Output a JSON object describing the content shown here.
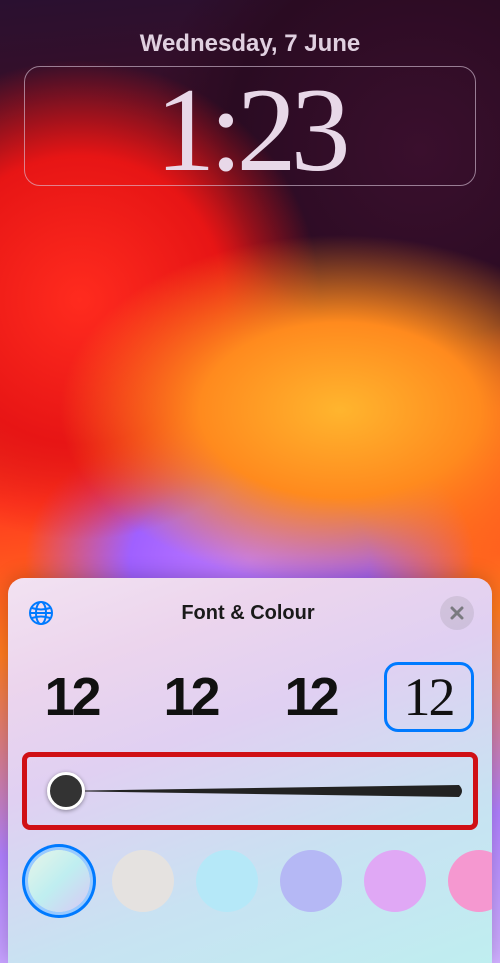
{
  "lockscreen": {
    "date": "Wednesday, 7 June",
    "time": "1:23"
  },
  "sheet": {
    "title": "Font & Colour",
    "globe_icon": "globe-icon",
    "close_icon": "close-icon",
    "fonts": [
      {
        "sample": "12",
        "selected": false
      },
      {
        "sample": "12",
        "selected": false
      },
      {
        "sample": "12",
        "selected": false
      },
      {
        "sample": "12",
        "selected": true
      }
    ],
    "slider": {
      "value": 0,
      "min": 0,
      "max": 100,
      "highlighted": true,
      "highlight_color": "#d01015"
    },
    "colors": [
      {
        "css": "linear-gradient(135deg,#e8f5e8 0%,#bfeef0 50%,#d8c8f5 100%)",
        "selected": true
      },
      {
        "css": "#e5e2e0",
        "selected": false
      },
      {
        "css": "#b5e8f8",
        "selected": false
      },
      {
        "css": "#b5b8f5",
        "selected": false
      },
      {
        "css": "#e0a8f5",
        "selected": false
      },
      {
        "css": "#f598d0",
        "selected": false
      }
    ]
  }
}
